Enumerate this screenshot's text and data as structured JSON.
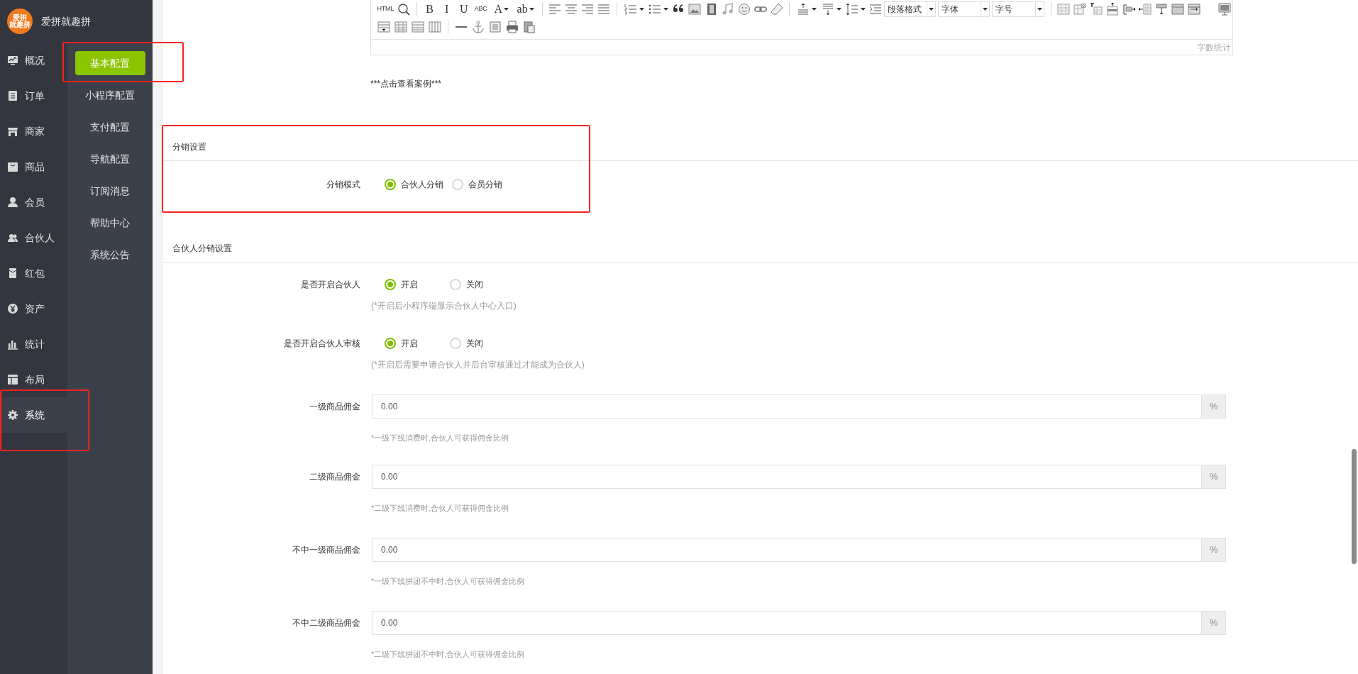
{
  "brand": {
    "logo_text": [
      "爱拼",
      "就趣拼"
    ],
    "name": "爱拼就趣拼"
  },
  "main_nav": [
    {
      "label": "概况",
      "selected": false,
      "highlighted": false
    },
    {
      "label": "订单",
      "selected": false,
      "highlighted": false
    },
    {
      "label": "商家",
      "selected": false,
      "highlighted": false
    },
    {
      "label": "商品",
      "selected": false,
      "highlighted": false
    },
    {
      "label": "会员",
      "selected": false,
      "highlighted": false
    },
    {
      "label": "合伙人",
      "selected": false,
      "highlighted": false
    },
    {
      "label": "红包",
      "selected": false,
      "highlighted": false
    },
    {
      "label": "资产",
      "selected": false,
      "highlighted": false
    },
    {
      "label": "统计",
      "selected": false,
      "highlighted": false
    },
    {
      "label": "布局",
      "selected": false,
      "highlighted": false
    },
    {
      "label": "系统",
      "selected": true,
      "highlighted": true
    }
  ],
  "sub_nav": [
    {
      "label": "基本配置",
      "selected": true,
      "highlighted": true
    },
    {
      "label": "小程序配置",
      "selected": false,
      "highlighted": false
    },
    {
      "label": "支付配置",
      "selected": false,
      "highlighted": false
    },
    {
      "label": "导航配置",
      "selected": false,
      "highlighted": false
    },
    {
      "label": "订阅消息",
      "selected": false,
      "highlighted": false
    },
    {
      "label": "帮助中心",
      "selected": false,
      "highlighted": false
    },
    {
      "label": "系统公告",
      "selected": false,
      "highlighted": false
    }
  ],
  "editor": {
    "toolbar": [
      [
        {
          "kind": "text",
          "label": "HTML"
        },
        {
          "kind": "icon"
        },
        {
          "kind": "separator"
        },
        {
          "kind": "text",
          "label": "B"
        },
        {
          "kind": "text",
          "label": "I"
        },
        {
          "kind": "text",
          "label": "U"
        },
        {
          "kind": "text",
          "label": "ABC"
        },
        {
          "kind": "text",
          "label": "A",
          "dropdown": true
        },
        {
          "kind": "text",
          "label": "ab",
          "dropdown": true
        },
        {
          "kind": "separator"
        },
        {
          "kind": "icon"
        },
        {
          "kind": "icon"
        },
        {
          "kind": "icon"
        },
        {
          "kind": "icon"
        },
        {
          "kind": "separator"
        },
        {
          "kind": "icon",
          "dropdown": true
        },
        {
          "kind": "icon",
          "dropdown": true
        },
        {
          "kind": "icon"
        },
        {
          "kind": "icon"
        },
        {
          "kind": "icon"
        },
        {
          "kind": "icon"
        },
        {
          "kind": "icon"
        },
        {
          "kind": "icon"
        },
        {
          "kind": "icon"
        },
        {
          "kind": "separator"
        },
        {
          "kind": "icon",
          "dropdown": true
        },
        {
          "kind": "icon",
          "dropdown": true
        },
        {
          "kind": "icon",
          "dropdown": true
        },
        {
          "kind": "icon"
        },
        {
          "kind": "select",
          "label": "段落格式"
        },
        {
          "kind": "select",
          "label": "字体"
        },
        {
          "kind": "select",
          "label": "字号"
        },
        {
          "kind": "separator"
        },
        {
          "kind": "icon"
        },
        {
          "kind": "icon"
        },
        {
          "kind": "icon"
        },
        {
          "kind": "icon"
        },
        {
          "kind": "icon"
        },
        {
          "kind": "icon"
        },
        {
          "kind": "icon"
        },
        {
          "kind": "icon"
        },
        {
          "kind": "icon"
        },
        {
          "kind": "spacer"
        },
        {
          "kind": "icon"
        }
      ],
      [
        {
          "kind": "icon"
        },
        {
          "kind": "icon"
        },
        {
          "kind": "icon"
        },
        {
          "kind": "icon"
        },
        {
          "kind": "separator"
        },
        {
          "kind": "icon"
        },
        {
          "kind": "icon"
        },
        {
          "kind": "icon"
        },
        {
          "kind": "icon"
        },
        {
          "kind": "icon"
        }
      ]
    ],
    "word_count": "字数统计"
  },
  "case_link": "***点击查看案例***",
  "sections": [
    {
      "title": "分销设置",
      "highlighted": true,
      "fields": [
        {
          "kind": "radio",
          "label": "分销模式",
          "options": [
            {
              "label": "合伙人分销",
              "selected": true
            },
            {
              "label": "会员分销",
              "selected": false
            }
          ]
        }
      ]
    },
    {
      "title": "合伙人分销设置",
      "highlighted": false,
      "fields": [
        {
          "kind": "radio",
          "label": "是否开启合伙人",
          "options": [
            {
              "label": "开启",
              "selected": true
            },
            {
              "label": "关闭",
              "selected": false
            }
          ],
          "hint": "(*开启后小程序端显示合伙人中心入口)"
        },
        {
          "kind": "radio",
          "label": "是否开启合伙人审核",
          "options": [
            {
              "label": "开启",
              "selected": true
            },
            {
              "label": "关闭",
              "selected": false
            }
          ],
          "hint": "(*开启后需要申请合伙人并后台审核通过才能成为合伙人)"
        },
        {
          "kind": "input",
          "label": "一级商品佣金",
          "value": "0.00",
          "unit": "%",
          "hint": "*一级下线消费时,合伙人可获得佣金比例"
        },
        {
          "kind": "input",
          "label": "二级商品佣金",
          "value": "0.00",
          "unit": "%",
          "hint": "*二级下线消费时,合伙人可获得佣金比例"
        },
        {
          "kind": "input",
          "label": "不中一级商品佣金",
          "value": "0.00",
          "unit": "%",
          "hint": "*一级下线拼团不中时,合伙人可获得佣金比例"
        },
        {
          "kind": "input",
          "label": "不中二级商品佣金",
          "value": "0.00",
          "unit": "%",
          "hint": "*二级下线拼团不中时,合伙人可获得佣金比例"
        }
      ]
    }
  ]
}
